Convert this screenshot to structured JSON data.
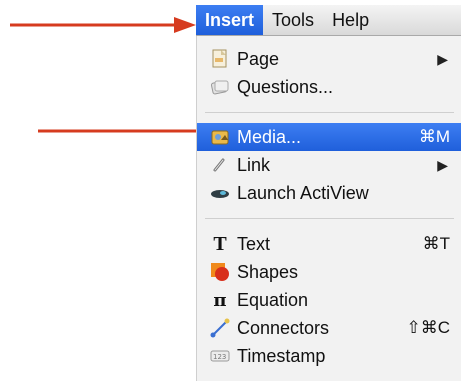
{
  "menubar": {
    "items": [
      {
        "label": "Insert",
        "active": true
      },
      {
        "label": "Tools"
      },
      {
        "label": "Help"
      }
    ]
  },
  "menu": {
    "items": [
      {
        "label": "Page",
        "icon": "page-icon",
        "submenu": true
      },
      {
        "label": "Questions...",
        "icon": "questions-icon"
      },
      {
        "label": "Media...",
        "icon": "media-icon",
        "shortcut": "⌘M",
        "highlighted": true
      },
      {
        "label": "Link",
        "icon": "link-icon",
        "submenu": true
      },
      {
        "label": "Launch ActiView",
        "icon": "actiview-icon"
      },
      {
        "label": "Text",
        "icon": "text-icon",
        "shortcut": "⌘T"
      },
      {
        "label": "Shapes",
        "icon": "shapes-icon"
      },
      {
        "label": "Equation",
        "icon": "equation-icon"
      },
      {
        "label": "Connectors",
        "icon": "connectors-icon",
        "shortcut": "⇧⌘C"
      },
      {
        "label": "Timestamp",
        "icon": "timestamp-icon"
      }
    ]
  },
  "colors": {
    "highlight": "#2a6ae6",
    "annotation_arrow": "#d63b1f"
  }
}
